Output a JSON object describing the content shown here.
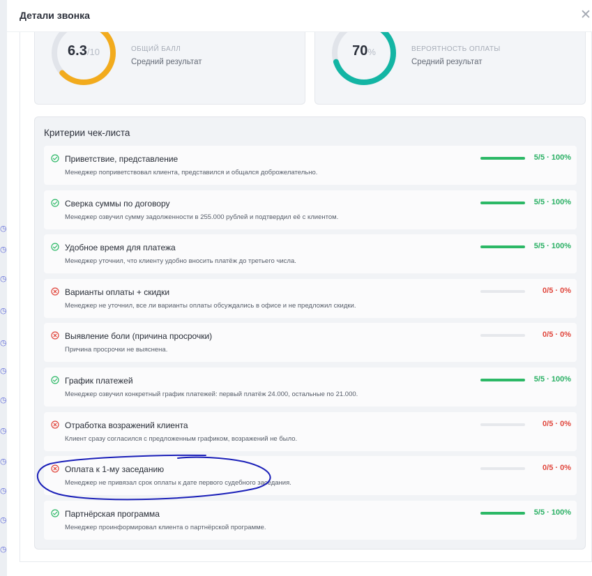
{
  "modal": {
    "title": "Детали звонка",
    "close_icon": "close-icon"
  },
  "scores": [
    {
      "value": "6.3",
      "unit": "/10",
      "label": "ОБЩИЙ БАЛЛ",
      "sub": "Средний результат",
      "fraction": 0.63,
      "color": "#f2ab1d"
    },
    {
      "value": "70",
      "unit": "%",
      "label": "ВЕРОЯТНОСТЬ ОПЛАТЫ",
      "sub": "Средний результат",
      "fraction": 0.7,
      "color": "#13b5a4"
    }
  ],
  "criteria": {
    "title": "Критерии чек-листа",
    "items": [
      {
        "title": "Приветствие, представление",
        "desc": "Менеджер поприветствовал клиента, представился и общался доброжелательно.",
        "score": "5/5 · 100%",
        "passed": true,
        "fraction": 1.0
      },
      {
        "title": "Сверка суммы по договору",
        "desc": "Менеджер озвучил сумму задолженности в 255.000 рублей и подтвердил её с клиентом.",
        "score": "5/5 · 100%",
        "passed": true,
        "fraction": 1.0
      },
      {
        "title": "Удобное время для платежа",
        "desc": "Менеджер уточнил, что клиенту удобно вносить платёж до третьего числа.",
        "score": "5/5 · 100%",
        "passed": true,
        "fraction": 1.0
      },
      {
        "title": "Варианты оплаты + скидки",
        "desc": "Менеджер не уточнил, все ли варианты оплаты обсуждались в офисе и не предложил скидки.",
        "score": "0/5 · 0%",
        "passed": false,
        "fraction": 0.0
      },
      {
        "title": "Выявление боли (причина просрочки)",
        "desc": "Причина просрочки не выяснена.",
        "score": "0/5 · 0%",
        "passed": false,
        "fraction": 0.0
      },
      {
        "title": "График платежей",
        "desc": "Менеджер озвучил конкретный график платежей: первый платёж 24.000, остальные по 21.000.",
        "score": "5/5 · 100%",
        "passed": true,
        "fraction": 1.0
      },
      {
        "title": "Отработка возражений клиента",
        "desc": "Клиент сразу согласился с предложенным графиком, возражений не было.",
        "score": "0/5 · 0%",
        "passed": false,
        "fraction": 0.0
      },
      {
        "title": "Оплата к 1-му заседанию",
        "desc": "Менеджер не привязал срок оплаты к дате первого судебного заседания.",
        "score": "0/5 · 0%",
        "passed": false,
        "fraction": 0.0
      },
      {
        "title": "Партнёрская программа",
        "desc": "Менеджер проинформировал клиента о партнёрской программе.",
        "score": "5/5 · 100%",
        "passed": true,
        "fraction": 1.0
      }
    ]
  },
  "colors": {
    "pass": "#2cb866",
    "fail": "#e0443a",
    "annotation": "#1a1fb8"
  }
}
